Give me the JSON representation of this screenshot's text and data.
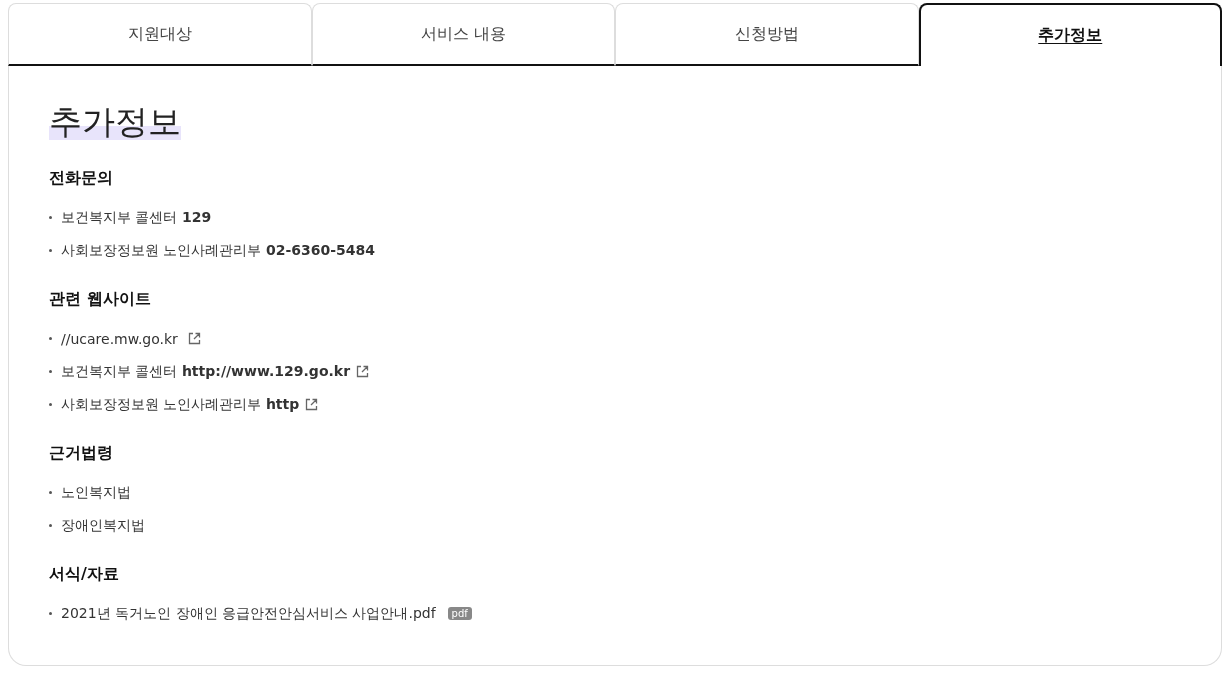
{
  "tabs": [
    {
      "label": "지원대상",
      "selected": false
    },
    {
      "label": "서비스 내용",
      "selected": false
    },
    {
      "label": "신청방법",
      "selected": false
    },
    {
      "label": "추가정보",
      "selected": true
    }
  ],
  "title": "추가정보",
  "sections": [
    {
      "heading": "전화문의",
      "items": [
        {
          "text": "보건복지부 콜센터 **129**"
        },
        {
          "text": "사회보장정보원 노인사례관리부 **02-6360-5484**"
        }
      ]
    },
    {
      "heading": "관련 웹사이트",
      "items": [
        {
          "text": "//ucare.mw.go.kr ",
          "external": true
        },
        {
          "text": "보건복지부 콜센터 **http://www.129.go.kr**",
          "external": true
        },
        {
          "text": "사회보장정보원 노인사례관리부 **http**",
          "external": true
        }
      ]
    },
    {
      "heading": "근거법령",
      "items": [
        {
          "text": "노인복지법"
        },
        {
          "text": "장애인복지법"
        }
      ]
    },
    {
      "heading": "서식/자료",
      "items": [
        {
          "text": "2021년 독거노인 장애인 응급안전안심서비스 사업안내.pdf",
          "badge": "pdf"
        }
      ]
    }
  ]
}
